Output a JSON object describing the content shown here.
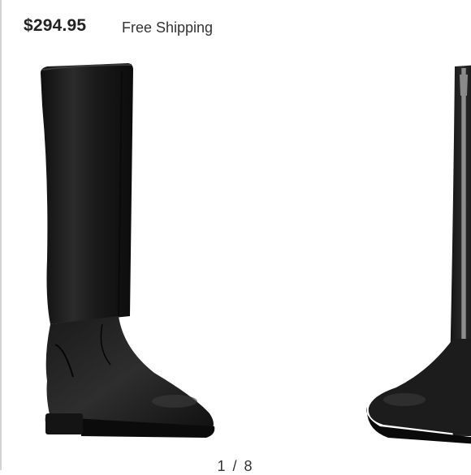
{
  "listing": {
    "price": "$294.95",
    "shipping": "Free Shipping"
  },
  "carousel": {
    "pager": "1 / 8",
    "current_index": 1,
    "total": 8,
    "slides": [
      {
        "icon": "black-knee-high-riding-boot-side-view"
      },
      {
        "icon": "black-knee-high-riding-boot-zipper-view"
      }
    ]
  },
  "colors": {
    "boot": "#1c1c1c",
    "text": "#222222",
    "background": "#ffffff"
  }
}
